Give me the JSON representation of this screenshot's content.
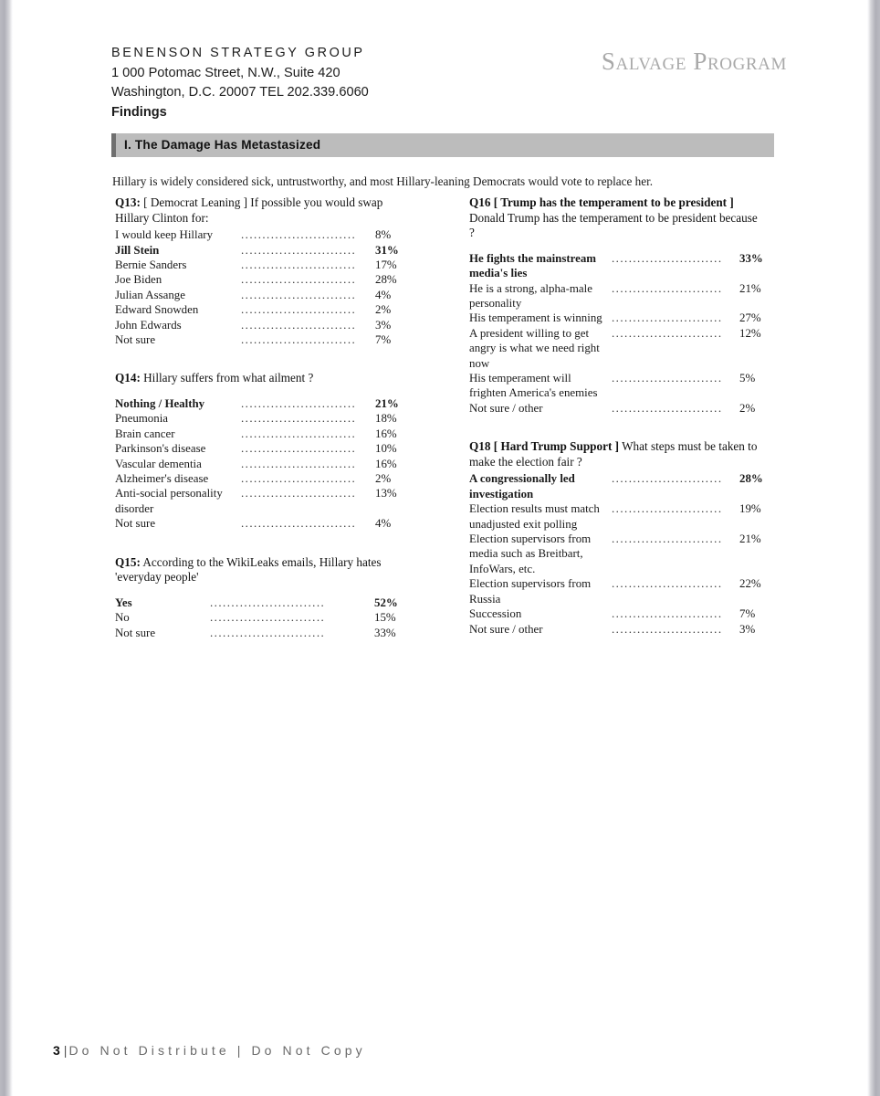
{
  "header": {
    "firm_name": "BENENSON STRATEGY GROUP",
    "address_line1": "1 000 Potomac Street, N.W., Suite 420",
    "address_line2": "Washington, D.C. 20007 TEL 202.339.6060",
    "doc_type": "Findings",
    "program_title": "Salvage Program"
  },
  "section": {
    "number": "I.",
    "title": "I.  The Damage Has Metastasized",
    "intro": "Hillary is widely considered sick, untrustworthy, and most Hillary-leaning Democrats would vote to replace her."
  },
  "colors": {
    "section_bar_fill": "#bcbcbc",
    "section_bar_accent": "#6f6f6f",
    "program_title": "#a9a9a9",
    "footer_text": "#6a6a6a",
    "page_edge": "#b0b0b8"
  },
  "questions": {
    "q13": {
      "code": "Q13:",
      "bracket": "",
      "prompt": " [ Democrat Leaning ] If possible you would swap Hillary Clinton for:",
      "rows": [
        {
          "label": "I would keep Hillary",
          "value": "8%",
          "bold": false
        },
        {
          "label": "Jill Stein",
          "value": "31%",
          "bold": true
        },
        {
          "label": "Bernie Sanders",
          "value": "17%",
          "bold": false
        },
        {
          "label": "Joe Biden",
          "value": "28%",
          "bold": false
        },
        {
          "label": "Julian Assange",
          "value": "4%",
          "bold": false
        },
        {
          "label": "Edward Snowden",
          "value": "2%",
          "bold": false
        },
        {
          "label": "John Edwards",
          "value": "3%",
          "bold": false
        },
        {
          "label": "Not sure",
          "value": "7%",
          "bold": false
        }
      ]
    },
    "q14": {
      "code": "Q14:",
      "prompt": " Hillary suffers from what ailment ?",
      "rows": [
        {
          "label": "Nothing / Healthy",
          "value": "21%",
          "bold": true
        },
        {
          "label": "Pneumonia",
          "value": "18%",
          "bold": false
        },
        {
          "label": "Brain cancer",
          "value": "16%",
          "bold": false
        },
        {
          "label": "Parkinson's disease",
          "value": "10%",
          "bold": false
        },
        {
          "label": "Vascular dementia",
          "value": "16%",
          "bold": false
        },
        {
          "label": "Alzheimer's disease",
          "value": "2%",
          "bold": false
        },
        {
          "label": "Anti-social personality disorder",
          "value": "13%",
          "bold": false
        },
        {
          "label": "Not sure",
          "value": "4%",
          "bold": false
        }
      ]
    },
    "q15": {
      "code": "Q15:",
      "prompt": " According to the WikiLeaks emails, Hillary hates 'everyday people'",
      "rows": [
        {
          "label": "Yes",
          "value": "52%",
          "bold": true
        },
        {
          "label": "No",
          "value": "15%",
          "bold": false
        },
        {
          "label": "Not sure",
          "value": "33%",
          "bold": false
        }
      ]
    },
    "q16": {
      "code": "Q16",
      "bracket": " [ Trump has the temperament to be president ]",
      "prompt": " Donald Trump has the temperament to be president because ?",
      "rows": [
        {
          "label": "He fights the mainstream media's lies",
          "value": "33%",
          "bold": true
        },
        {
          "label": "He is a strong, alpha-male personality",
          "value": "21%",
          "bold": false
        },
        {
          "label": "His temperament is winning",
          "value": "27%",
          "bold": false
        },
        {
          "label": "A president willing to get angry is what we need right now",
          "value": "12%",
          "bold": false
        },
        {
          "label": "His temperament will frighten America's enemies",
          "value": "5%",
          "bold": false
        },
        {
          "label": "Not sure / other",
          "value": "2%",
          "bold": false
        }
      ]
    },
    "q18": {
      "code": "Q18",
      "bracket": " [ Hard Trump Support ]",
      "prompt": " What steps must be taken to make the election fair ?",
      "rows": [
        {
          "label": "A congressionally led investigation",
          "value": "28%",
          "bold": true
        },
        {
          "label": "Election results must match unadjusted exit polling",
          "value": "19%",
          "bold": false
        },
        {
          "label": "Election supervisors from media such as Breitbart, InfoWars, etc.",
          "value": "21%",
          "bold": false
        },
        {
          "label": "Election supervisors from Russia",
          "value": "22%",
          "bold": false
        },
        {
          "label": "Succession",
          "value": "7%",
          "bold": false
        },
        {
          "label": "Not sure / other",
          "value": "3%",
          "bold": false
        }
      ]
    }
  },
  "footer": {
    "page_number": "3",
    "separator": "|",
    "text": "Do Not Distribute  |  Do Not Copy"
  }
}
